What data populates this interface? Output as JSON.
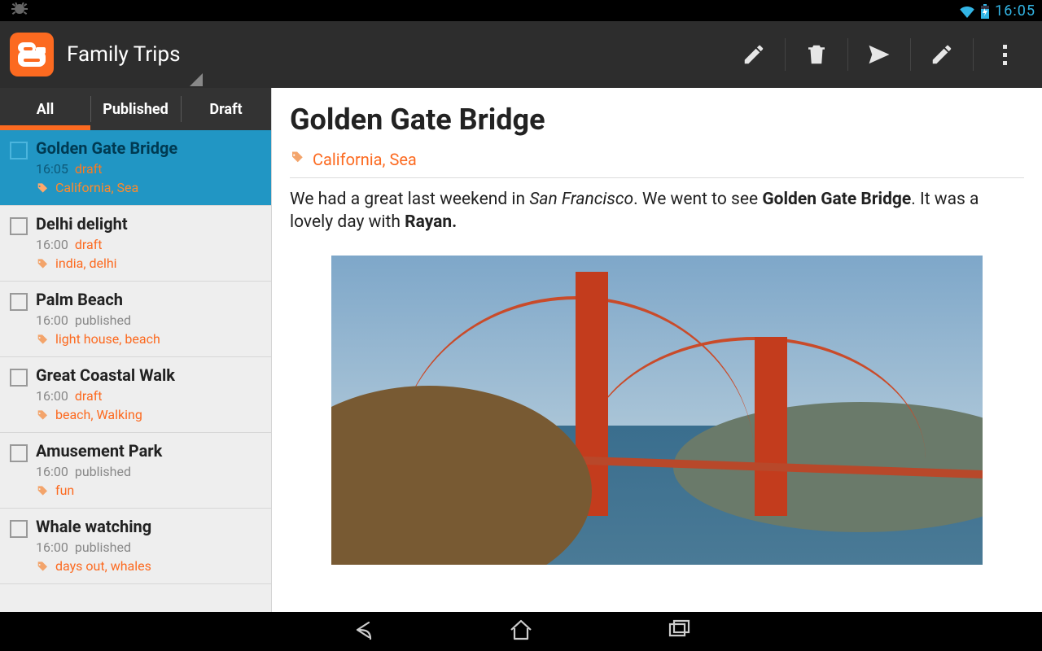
{
  "statusbar": {
    "time": "16:05"
  },
  "actionbar": {
    "title": "Family Trips"
  },
  "tabs": {
    "all": "All",
    "published": "Published",
    "draft": "Draft",
    "active": "all"
  },
  "posts": [
    {
      "title": "Golden Gate Bridge",
      "time": "16:05",
      "status": "draft",
      "status_label": "draft",
      "tags": "California, Sea",
      "selected": true
    },
    {
      "title": "Delhi delight",
      "time": "16:00",
      "status": "draft",
      "status_label": "draft",
      "tags": "india, delhi",
      "selected": false
    },
    {
      "title": "Palm Beach",
      "time": "16:00",
      "status": "published",
      "status_label": "published",
      "tags": "light house, beach",
      "selected": false
    },
    {
      "title": "Great Coastal Walk",
      "time": "16:00",
      "status": "draft",
      "status_label": "draft",
      "tags": "beach, Walking",
      "selected": false
    },
    {
      "title": "Amusement Park",
      "time": "16:00",
      "status": "published",
      "status_label": "published",
      "tags": "fun",
      "selected": false
    },
    {
      "title": "Whale watching",
      "time": "16:00",
      "status": "published",
      "status_label": "published",
      "tags": "days out, whales",
      "selected": false
    }
  ],
  "post": {
    "title": "Golden Gate Bridge",
    "tags": "California, Sea",
    "body_pre": "We had a great last weekend in ",
    "body_em": "San Francisco",
    "body_mid": ". We went to see ",
    "body_b1": "Golden Gate Bridge",
    "body_mid2": ". It was a lovely day with ",
    "body_b2": "Rayan."
  }
}
